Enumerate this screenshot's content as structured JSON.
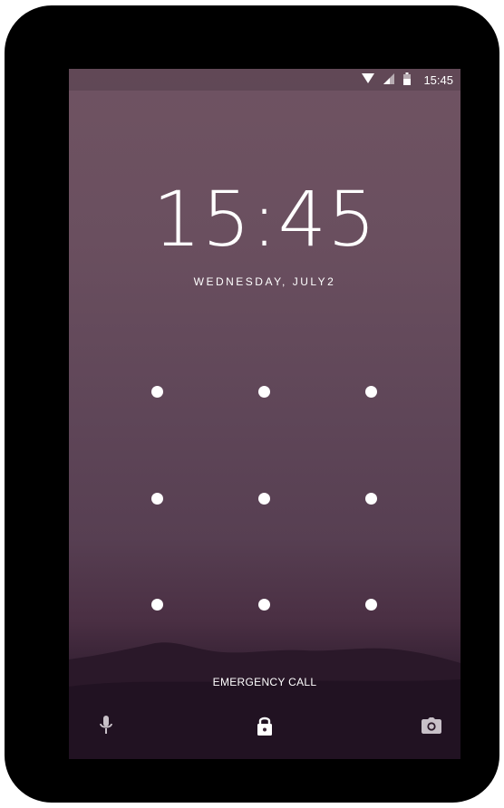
{
  "status_bar": {
    "time": "15:45",
    "icons": [
      "wifi-icon",
      "signal-icon",
      "battery-icon"
    ]
  },
  "lockscreen": {
    "clock": "15:45",
    "date": "WEDNESDAY, JULY2",
    "emergency_label": "EMERGENCY CALL",
    "pattern_grid": {
      "rows": 3,
      "cols": 3
    }
  },
  "bottom_actions": [
    "voice-assist-icon",
    "lock-icon",
    "camera-icon"
  ],
  "colors": {
    "bezel": "#000000",
    "wallpaper_top": "#6f5362",
    "wallpaper_bottom": "#1c1220",
    "text": "#ffffff",
    "icon_gray": "#c8c0c8"
  }
}
